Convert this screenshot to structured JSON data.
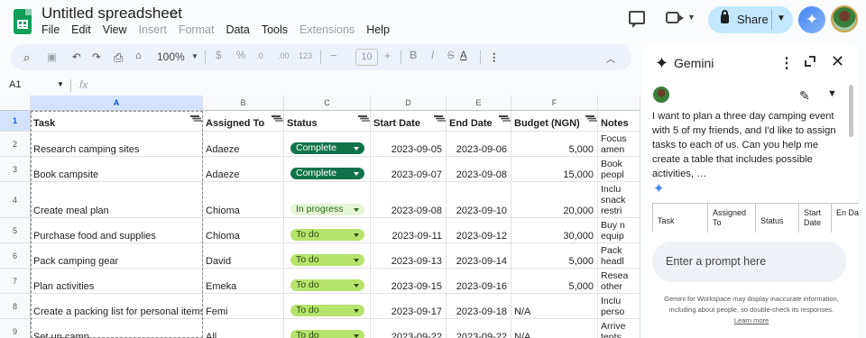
{
  "title_bar": {
    "doc_title": "Untitled spreadsheet",
    "menus": [
      {
        "label": "File",
        "enabled": true
      },
      {
        "label": "Edit",
        "enabled": true
      },
      {
        "label": "View",
        "enabled": true
      },
      {
        "label": "Insert",
        "enabled": false
      },
      {
        "label": "Format",
        "enabled": false
      },
      {
        "label": "Data",
        "enabled": true
      },
      {
        "label": "Tools",
        "enabled": true
      },
      {
        "label": "Extensions",
        "enabled": false
      },
      {
        "label": "Help",
        "enabled": true
      }
    ],
    "share_label": "Share",
    "icons": [
      "sheets-logo-icon",
      "star-icon",
      "comment-icon",
      "video-call-icon",
      "lock-icon",
      "gemini-icon",
      "avatar"
    ]
  },
  "toolbar": {
    "zoom": "100%",
    "currency": "$",
    "percent": "%",
    "dec_decrease": ".0",
    "dec_increase": ".00",
    "number_format": "123",
    "font_size": "10",
    "minus": "−",
    "plus": "+"
  },
  "formula_bar": {
    "cell_ref": "A1",
    "fx": "fx"
  },
  "sheet": {
    "columns": [
      "A",
      "B",
      "C",
      "D",
      "E",
      "F"
    ],
    "row_numbers": [
      "1",
      "2",
      "3",
      "4",
      "5",
      "6",
      "7",
      "8",
      "9"
    ],
    "header": [
      "Task",
      "Assigned To",
      "Status",
      "Start Date",
      "End Date",
      "Budget (NGN)",
      "Notes"
    ],
    "rows": [
      {
        "task": "Research camping sites",
        "assigned": "Adaeze",
        "status": "Complete",
        "start": "2023-09-05",
        "end": "2023-09-06",
        "budget": "5,000",
        "notes": "Focus\namen"
      },
      {
        "task": "Book campsite",
        "assigned": "Adaeze",
        "status": "Complete",
        "start": "2023-09-07",
        "end": "2023-09-08",
        "budget": "15,000",
        "notes": "Book\npeopl"
      },
      {
        "task": "Create meal plan",
        "assigned": "Chioma",
        "status": "In progress",
        "start": "2023-09-08",
        "end": "2023-09-10",
        "budget": "20,000",
        "notes": "Inclu\nsnack\nrestri"
      },
      {
        "task": "Purchase food and supplies",
        "assigned": "Chioma",
        "status": "To do",
        "start": "2023-09-11",
        "end": "2023-09-12",
        "budget": "30,000",
        "notes": "Buy n\nequip"
      },
      {
        "task": "Pack camping gear",
        "assigned": "David",
        "status": "To do",
        "start": "2023-09-13",
        "end": "2023-09-14",
        "budget": "5,000",
        "notes": "Pack\nheadl"
      },
      {
        "task": "Plan activities",
        "assigned": "Emeka",
        "status": "To do",
        "start": "2023-09-15",
        "end": "2023-09-16",
        "budget": "5,000",
        "notes": "Resea\nother"
      },
      {
        "task": "Create a packing list for personal items",
        "assigned": "Femi",
        "status": "To do",
        "start": "2023-09-17",
        "end": "2023-09-18",
        "budget": "N/A",
        "notes": "Inclu\nperso"
      },
      {
        "task": "Set up camp",
        "assigned": "All",
        "status": "To do",
        "start": "2023-09-22",
        "end": "2023-09-22",
        "budget": "N/A",
        "notes": "Arrive\ntents,"
      }
    ]
  },
  "gemini": {
    "title": "Gemini",
    "prompt": "I want to plan a three day camping event with 5 of my friends, and I'd like to assign tasks to each of us. Can you help me create a table that includes possible activities, …",
    "table_headers": [
      "Task",
      "Assigned To",
      "Status",
      "Start Date",
      "En Da"
    ],
    "input_placeholder": "Enter a prompt here",
    "disclaimer": "Gemini for Workspace may display inaccurate information, including about people, so double-check its responses.",
    "learn_more": "Learn more"
  },
  "colors": {
    "complete_chip": "#11734b",
    "in_progress_chip": "#e6f4d7",
    "todo_chip": "#b6e36b",
    "share_button": "#c2e7ff",
    "selection": "#d3e3fd"
  }
}
